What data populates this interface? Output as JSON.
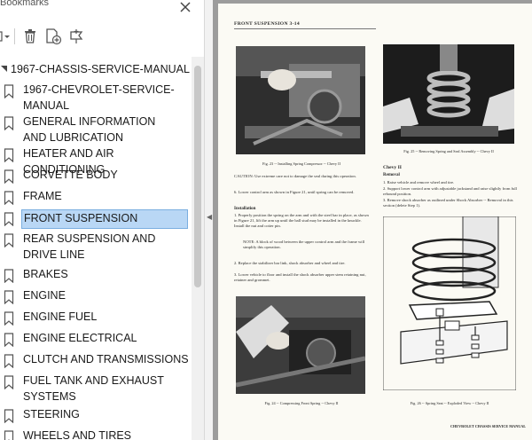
{
  "bookmarks_panel": {
    "title": "Bookmarks",
    "close_glyph": "✕",
    "toolbar": {
      "options_icon": "options-dropdown-icon",
      "delete_icon": "delete-bookmark-icon",
      "new_icon": "new-bookmark-icon",
      "expand_icon": "expand-bookmark-icon"
    },
    "root": {
      "label": "1967-CHASSIS-SERVICE-MANUAL"
    },
    "items": [
      {
        "label": "1967-CHEVROLET-SERVICE-MANUAL"
      },
      {
        "label": "GENERAL INFORMATION AND LUBRICATION"
      },
      {
        "label": "HEATER AND AIR CONDITIONING"
      },
      {
        "label": "CORVETTE BODY"
      },
      {
        "label": "FRAME"
      },
      {
        "label": "FRONT SUSPENSION",
        "selected": true
      },
      {
        "label": "REAR SUSPENSION AND DRIVE LINE"
      },
      {
        "label": "BRAKES"
      },
      {
        "label": "ENGINE"
      },
      {
        "label": "ENGINE FUEL"
      },
      {
        "label": "ENGINE ELECTRICAL"
      },
      {
        "label": "CLUTCH AND TRANSMISSIONS"
      },
      {
        "label": "FUEL TANK AND EXHAUST SYSTEMS"
      },
      {
        "label": "STEERING"
      },
      {
        "label": "WHEELS AND TIRES"
      }
    ],
    "accent_color": "#b9d7f5"
  },
  "page": {
    "header": "FRONT SUSPENSION 3-14",
    "fig23_caption": "Fig. 23 -- Installing Spring Compressor -- Chevy II",
    "fig25_caption": "Fig. 25 -- Removing Spring and Seal Assembly -- Chevy II",
    "caution": "CAUTION:   Use extreme care not to damage the seal during this operation.",
    "step6": "6.  Lower control arm as shown in Figure 21, until spring can be removed.",
    "installation_title": "Installation",
    "install_1": "1.  Properly position the spring on the arm and with the steel bar in place, as shown in Figure 21, lift the arm up until the ball stud may be installed in the knuckle. Install the nut and cotter pin.",
    "note": "NOTE:   A block of wood between the upper control arm and the frame will simplify this operation.",
    "install_2": "2.  Replace the stabilizer bar link, shock absorber and wheel and tire.",
    "install_3": "3.  Lower vehicle to floor and install the shock absorber upper stem retaining nut, retainer and grommet.",
    "chevy_title": "Chevy II",
    "removal_title": "Removal",
    "removal_1": "1.  Raise vehicle and remove wheel and tire.",
    "removal_2": "2.  Support lower control arm with adjustable jackstand and raise slightly from full rebound position.",
    "removal_3": "3.  Remove shock absorber as outlined under Shock Absorber -- Removal in this section (delete Step 1).",
    "fig24_caption": "Fig. 24 -- Compressing Front Spring -- Chevy II",
    "fig26_caption": "Fig. 26 -- Spring Seat -- Exploded View -- Chevy II",
    "footer": "CHEVROLET CHASSIS SERVICE MANUAL"
  }
}
